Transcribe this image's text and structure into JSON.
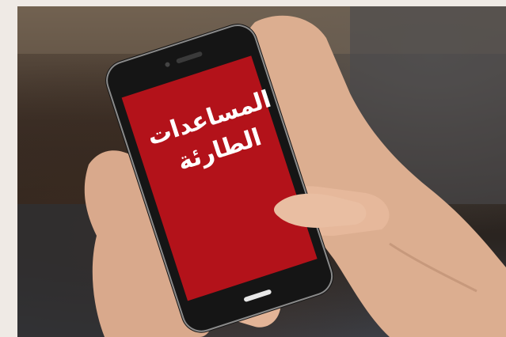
{
  "photo": {
    "subject": "",
    "screen_text": {
      "line1": "المساعدات",
      "line2": "الطارئة"
    },
    "colors": {
      "screen": "#b3121a",
      "phone_body": "#151515",
      "skin": "#e0b59a",
      "background": "#efeae5"
    }
  }
}
